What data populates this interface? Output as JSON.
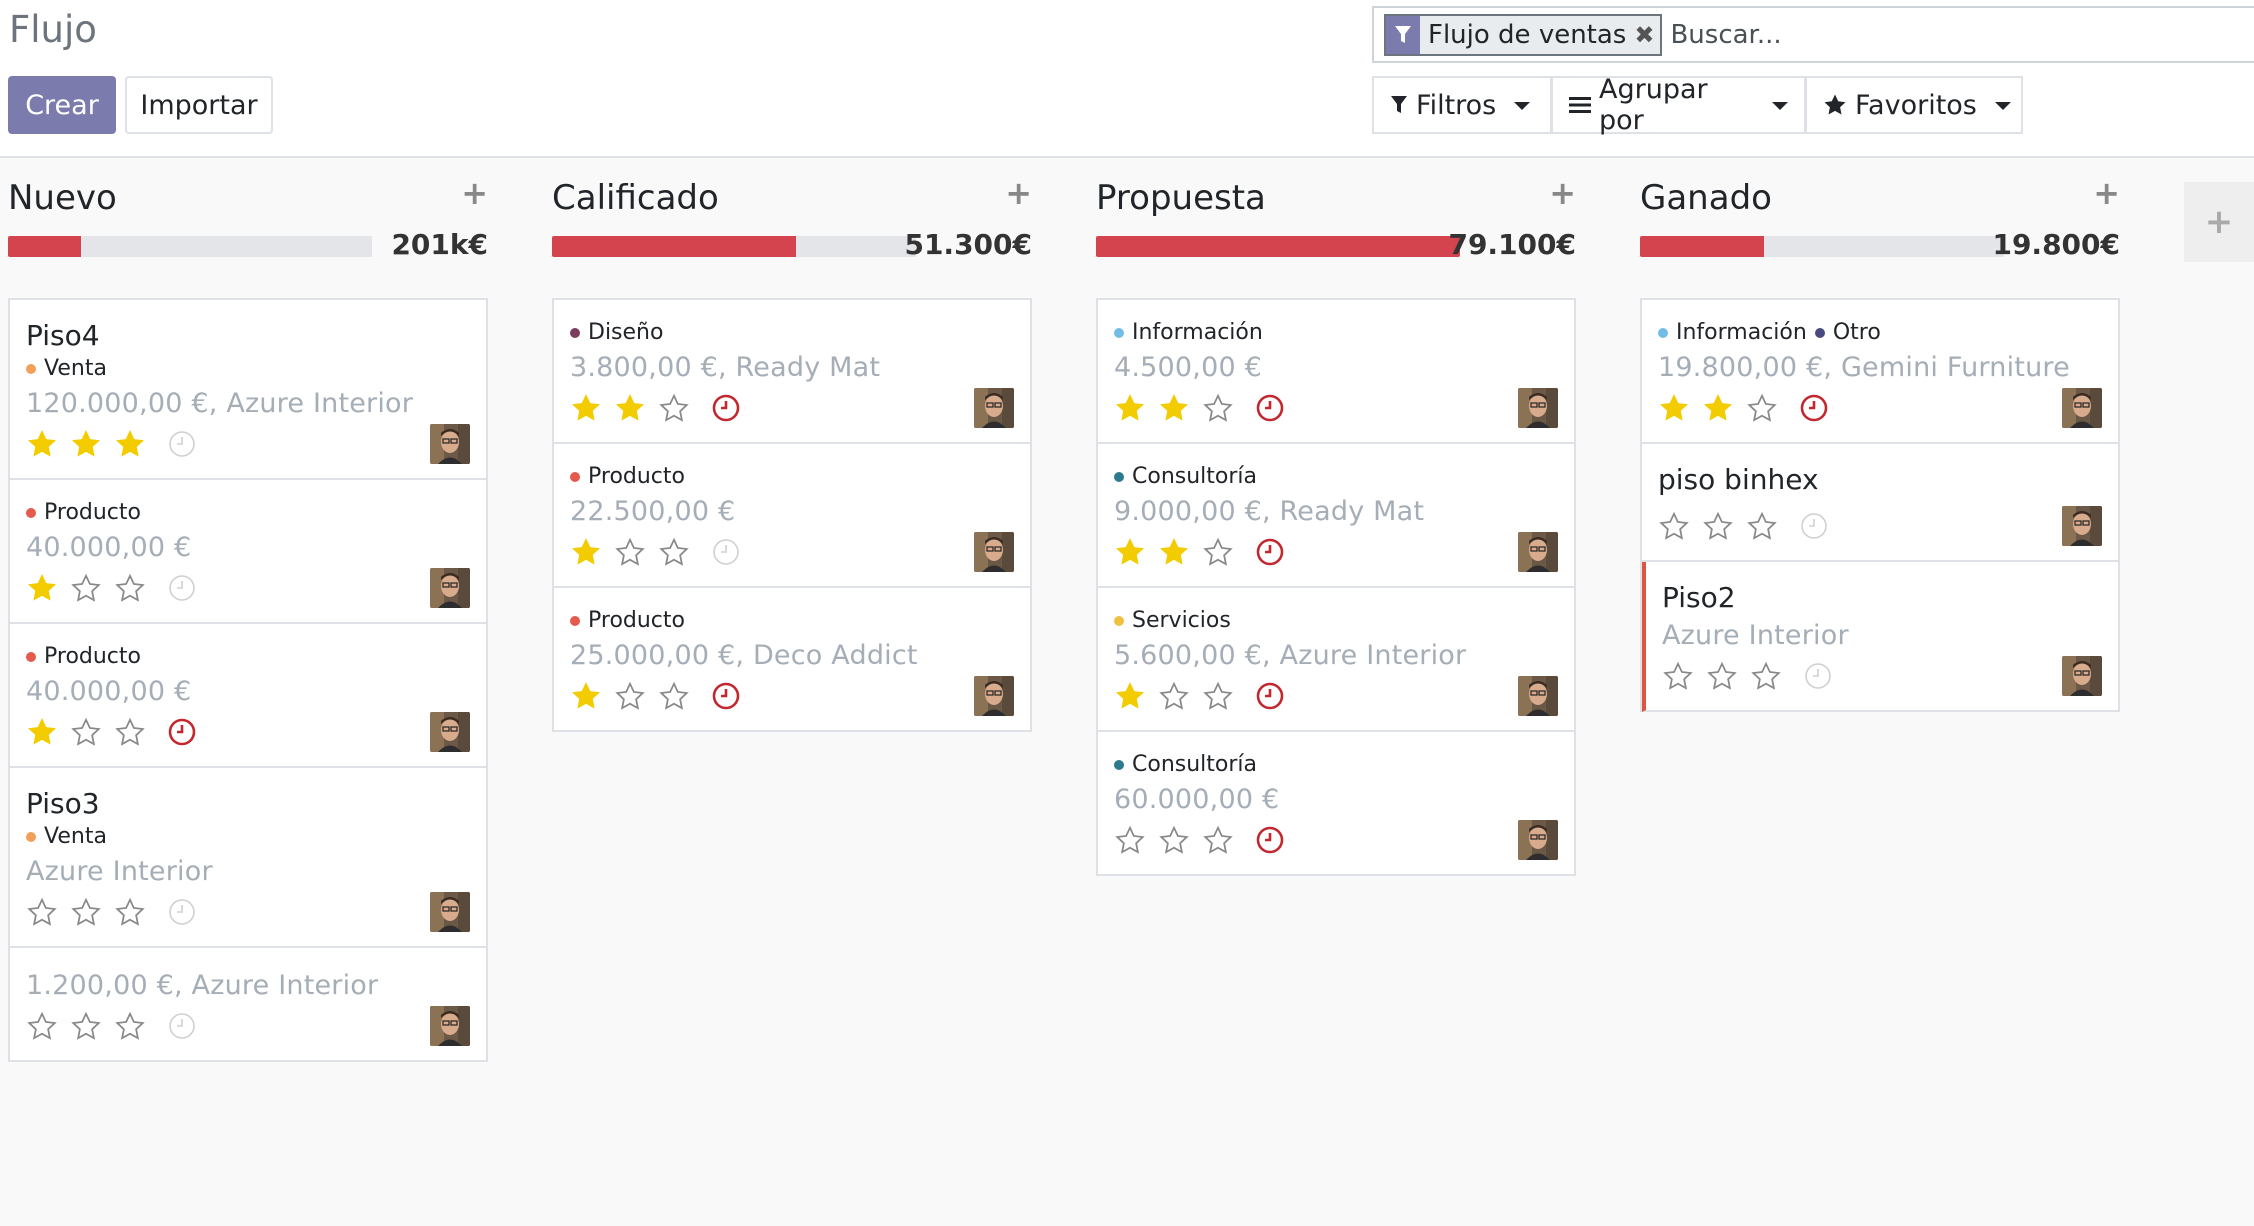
{
  "breadcrumb": "Flujo",
  "buttons": {
    "create": "Crear",
    "import": "Importar"
  },
  "search": {
    "facet": "Flujo de ventas",
    "placeholder": "Buscar..."
  },
  "filters": {
    "filtros": "Filtros",
    "agrupar": "Agrupar por",
    "favoritos": "Favoritos"
  },
  "colors": {
    "accent": "#7c7bad",
    "progress": "#d4444e",
    "activity_due": "#c2272d",
    "priority_star": "#f3cc00",
    "tag_venta": "#f0a058",
    "tag_producto": "#e65a4b",
    "tag_diseno": "#7b3b5b",
    "tag_informacion": "#72bde7",
    "tag_consultoria": "#2d7a8a",
    "tag_servicios": "#f0c040",
    "tag_otro": "#4a4a82"
  },
  "columns": [
    {
      "title": "Nuevo",
      "total": "201k€",
      "progress": 0.2,
      "cards": [
        {
          "name": "Piso4",
          "tags": [
            {
              "label": "Venta",
              "color": "#f0a058"
            }
          ],
          "subtitle": "120.000,00 €, Azure Interior",
          "stars": 3,
          "activity": "none"
        },
        {
          "name": "",
          "tags": [
            {
              "label": "Producto",
              "color": "#e65a4b"
            }
          ],
          "subtitle": "40.000,00 €",
          "stars": 1,
          "activity": "none"
        },
        {
          "name": "",
          "tags": [
            {
              "label": "Producto",
              "color": "#e65a4b"
            }
          ],
          "subtitle": "40.000,00 €",
          "stars": 1,
          "activity": "overdue"
        },
        {
          "name": "Piso3",
          "tags": [
            {
              "label": "Venta",
              "color": "#f0a058"
            }
          ],
          "subtitle": "Azure Interior",
          "stars": 0,
          "activity": "none"
        },
        {
          "name": "",
          "tags": [],
          "subtitle": "1.200,00 €, Azure Interior",
          "stars": 0,
          "activity": "none"
        }
      ]
    },
    {
      "title": "Calificado",
      "total": "51.300€",
      "progress": 0.67,
      "cards": [
        {
          "name": "",
          "tags": [
            {
              "label": "Diseño",
              "color": "#7b3b5b"
            }
          ],
          "subtitle": "3.800,00 €, Ready Mat",
          "stars": 2,
          "activity": "overdue"
        },
        {
          "name": "",
          "tags": [
            {
              "label": "Producto",
              "color": "#e65a4b"
            }
          ],
          "subtitle": "22.500,00 €",
          "stars": 1,
          "activity": "none"
        },
        {
          "name": "",
          "tags": [
            {
              "label": "Producto",
              "color": "#e65a4b"
            }
          ],
          "subtitle": "25.000,00 €, Deco Addict",
          "stars": 1,
          "activity": "overdue"
        }
      ]
    },
    {
      "title": "Propuesta",
      "total": "79.100€",
      "progress": 1.0,
      "cards": [
        {
          "name": "",
          "tags": [
            {
              "label": "Información",
              "color": "#72bde7"
            }
          ],
          "subtitle": "4.500,00 €",
          "stars": 2,
          "activity": "overdue"
        },
        {
          "name": "",
          "tags": [
            {
              "label": "Consultoría",
              "color": "#2d7a8a"
            }
          ],
          "subtitle": "9.000,00 €, Ready Mat",
          "stars": 2,
          "activity": "overdue"
        },
        {
          "name": "",
          "tags": [
            {
              "label": "Servicios",
              "color": "#f0c040"
            }
          ],
          "subtitle": "5.600,00 €, Azure Interior",
          "stars": 1,
          "activity": "overdue"
        },
        {
          "name": "",
          "tags": [
            {
              "label": "Consultoría",
              "color": "#2d7a8a"
            }
          ],
          "subtitle": "60.000,00 €",
          "stars": 0,
          "activity": "overdue"
        }
      ]
    },
    {
      "title": "Ganado",
      "total": "19.800€",
      "progress": 0.34,
      "cards": [
        {
          "name": "",
          "tags": [
            {
              "label": "Información",
              "color": "#72bde7"
            },
            {
              "label": "Otro",
              "color": "#4a4a82"
            }
          ],
          "subtitle": "19.800,00 €, Gemini Furniture",
          "stars": 2,
          "activity": "overdue"
        },
        {
          "name": "piso binhex",
          "tags": [],
          "subtitle": "",
          "stars": 0,
          "activity": "none"
        },
        {
          "name": "Piso2",
          "tags": [],
          "subtitle": "Azure Interior",
          "stars": 0,
          "activity": "none",
          "highlight": true
        }
      ]
    }
  ]
}
